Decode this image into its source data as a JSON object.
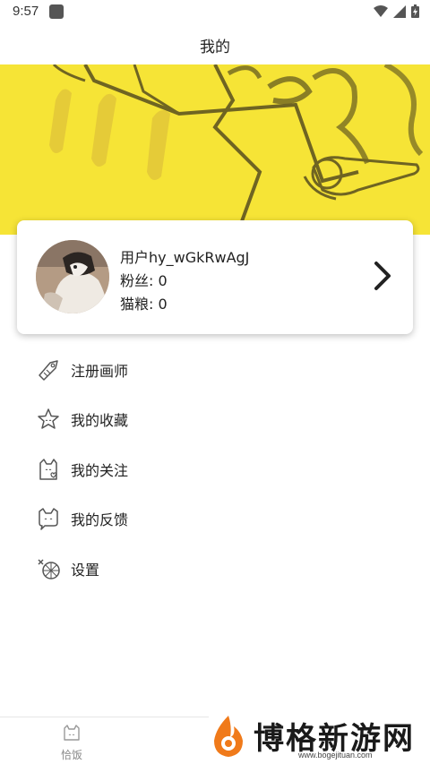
{
  "status_bar": {
    "time": "9:57"
  },
  "header": {
    "title": "我的"
  },
  "profile": {
    "username": "用户hy_wGkRwAgJ",
    "fans": "粉丝: 0",
    "cat_food": "猫粮: 0"
  },
  "menu": {
    "items": [
      {
        "label": "注册画师",
        "icon": "paw-tag-icon"
      },
      {
        "label": "我的收藏",
        "icon": "star-icon"
      },
      {
        "label": "我的关注",
        "icon": "cat-heart-icon"
      },
      {
        "label": "我的反馈",
        "icon": "cat-chat-icon"
      },
      {
        "label": "设置",
        "icon": "fish-bone-icon"
      }
    ]
  },
  "tab_bar": {
    "items": [
      {
        "label": "恰饭",
        "icon": "cat-bowl-icon"
      }
    ]
  },
  "watermark": {
    "text": "博格新游网",
    "url": "www.bogejituan.com"
  },
  "colors": {
    "banner": "#f6e436",
    "banner_line": "#6f6422",
    "orange": "#f07a1a"
  }
}
